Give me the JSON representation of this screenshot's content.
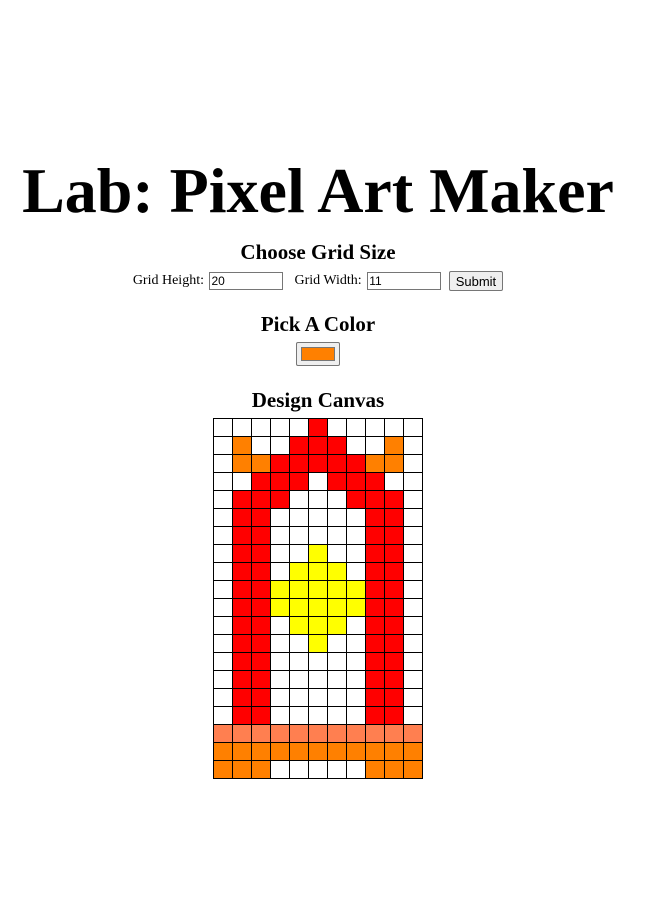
{
  "title": "Lab: Pixel Art Maker",
  "grid_size": {
    "heading": "Choose Grid Size",
    "height_label": "Grid Height:",
    "height_value": "20",
    "width_label": "Grid Width:",
    "width_value": "11",
    "submit_label": "Submit"
  },
  "color": {
    "heading": "Pick A Color",
    "value": "#ff8000"
  },
  "canvas": {
    "heading": "Design Canvas",
    "rows": 20,
    "columns": 11,
    "palette": {
      "W": "#ffffff",
      "R": "#ff0000",
      "O": "#ff8000",
      "Y": "#ffff00",
      "S": "#ff7f50"
    },
    "pixels": [
      "WWWWWRWWWWW",
      "WOWWRRRWWOW",
      "WOORRRRROOW",
      "WWRRRWRRRWW",
      "WRRRWWWRRRW",
      "WRRWWWWWRRW",
      "WRRWWWWWRRW",
      "WRRWWYWWRRW",
      "WRRWYYYWRRW",
      "WRRYYYYYRRW",
      "WRRYYYYYRRW",
      "WRRWYYYWRRW",
      "WRRWWYWWRRW",
      "WRRWWWWWRRW",
      "WRRWWWWWRRW",
      "WRRWWWWWRRW",
      "WRRWWWWWRRW",
      "SSSSSSSSSSS",
      "OOOOOOOOOOO",
      "OOOWWWWWOOO"
    ]
  }
}
